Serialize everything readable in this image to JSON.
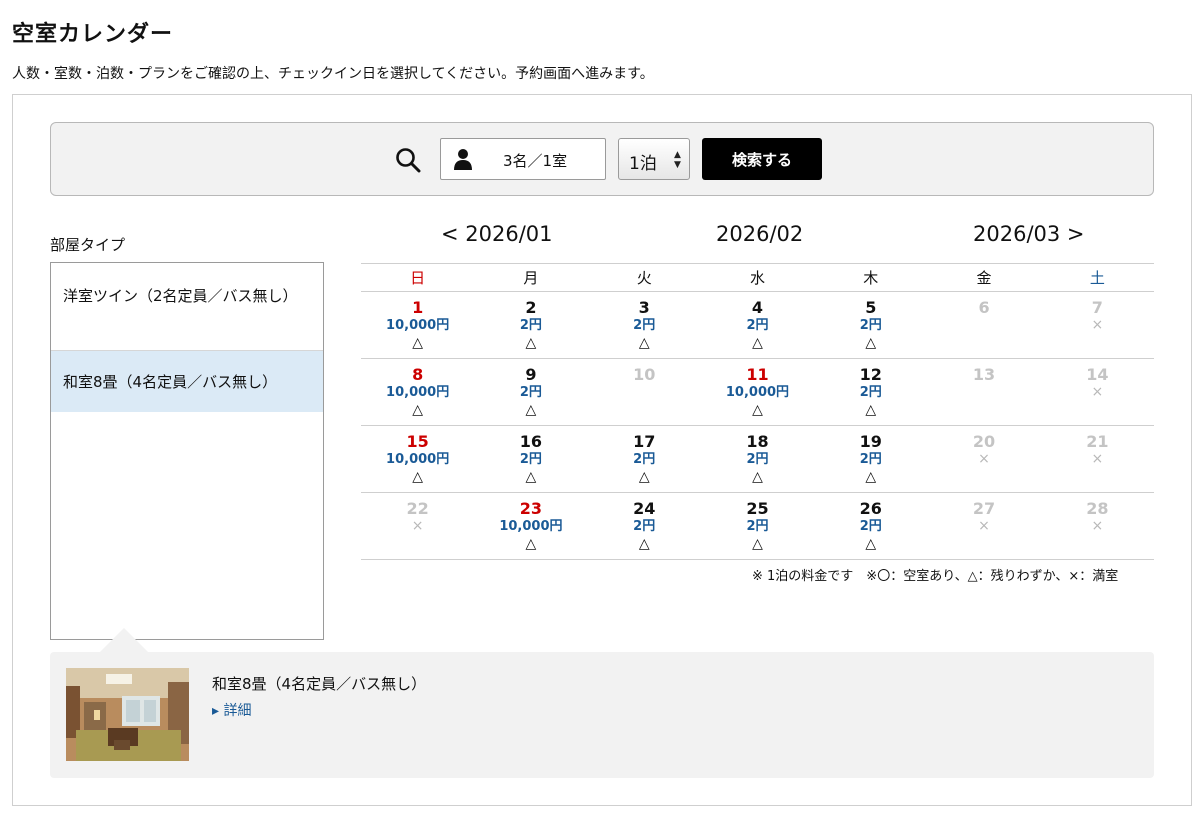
{
  "header": {
    "title": "空室カレンダー",
    "subtitle": "人数・室数・泊数・プランをご確認の上、チェックイン日を選択してください。予約画面へ進みます。"
  },
  "search": {
    "guests_value": "3名／1室",
    "nights_value": "1泊",
    "button_label": "検索する"
  },
  "rooms": {
    "label": "部屋タイプ",
    "items": [
      {
        "name": "洋室ツイン（2名定員／バス無し）",
        "selected": false
      },
      {
        "name": "和室8畳（4名定員／バス無し）",
        "selected": true
      }
    ]
  },
  "calendar": {
    "prev_month": "< 2026/01",
    "current_month": "2026/02",
    "next_month": "2026/03 >",
    "weekdays": [
      "日",
      "月",
      "火",
      "水",
      "木",
      "金",
      "土"
    ],
    "weeks": [
      [
        {
          "day": "1",
          "price": "10,000円",
          "avail": "△",
          "state": "holiday"
        },
        {
          "day": "2",
          "price": "2円",
          "avail": "△",
          "state": "normal"
        },
        {
          "day": "3",
          "price": "2円",
          "avail": "△",
          "state": "normal"
        },
        {
          "day": "4",
          "price": "2円",
          "avail": "△",
          "state": "normal"
        },
        {
          "day": "5",
          "price": "2円",
          "avail": "△",
          "state": "normal"
        },
        {
          "day": "6",
          "price": "",
          "avail": "",
          "state": "disabled"
        },
        {
          "day": "7",
          "price": "",
          "avail": "×",
          "state": "disabled"
        }
      ],
      [
        {
          "day": "8",
          "price": "10,000円",
          "avail": "△",
          "state": "holiday"
        },
        {
          "day": "9",
          "price": "2円",
          "avail": "△",
          "state": "normal"
        },
        {
          "day": "10",
          "price": "",
          "avail": "",
          "state": "disabled"
        },
        {
          "day": "11",
          "price": "10,000円",
          "avail": "△",
          "state": "holiday"
        },
        {
          "day": "12",
          "price": "2円",
          "avail": "△",
          "state": "normal"
        },
        {
          "day": "13",
          "price": "",
          "avail": "",
          "state": "disabled"
        },
        {
          "day": "14",
          "price": "",
          "avail": "×",
          "state": "disabled"
        }
      ],
      [
        {
          "day": "15",
          "price": "10,000円",
          "avail": "△",
          "state": "holiday"
        },
        {
          "day": "16",
          "price": "2円",
          "avail": "△",
          "state": "normal"
        },
        {
          "day": "17",
          "price": "2円",
          "avail": "△",
          "state": "normal"
        },
        {
          "day": "18",
          "price": "2円",
          "avail": "△",
          "state": "normal"
        },
        {
          "day": "19",
          "price": "2円",
          "avail": "△",
          "state": "normal"
        },
        {
          "day": "20",
          "price": "",
          "avail": "×",
          "state": "disabled"
        },
        {
          "day": "21",
          "price": "",
          "avail": "×",
          "state": "disabled"
        }
      ],
      [
        {
          "day": "22",
          "price": "",
          "avail": "×",
          "state": "disabled"
        },
        {
          "day": "23",
          "price": "10,000円",
          "avail": "△",
          "state": "holiday"
        },
        {
          "day": "24",
          "price": "2円",
          "avail": "△",
          "state": "normal"
        },
        {
          "day": "25",
          "price": "2円",
          "avail": "△",
          "state": "normal"
        },
        {
          "day": "26",
          "price": "2円",
          "avail": "△",
          "state": "normal"
        },
        {
          "day": "27",
          "price": "",
          "avail": "×",
          "state": "disabled"
        },
        {
          "day": "28",
          "price": "",
          "avail": "×",
          "state": "disabled"
        }
      ]
    ],
    "legend": "※ 1泊の料金です　※〇：空室あり、△：残りわずか、×：満室"
  },
  "detail": {
    "room_name": "和室8畳（4名定員／バス無し）",
    "link_label": "▸ 詳細"
  },
  "colors": {
    "accent_blue": "#1a5a96",
    "holiday_red": "#cc0000",
    "selected_bg": "#dbeaf6",
    "panel_bg": "#f2f2f2"
  }
}
